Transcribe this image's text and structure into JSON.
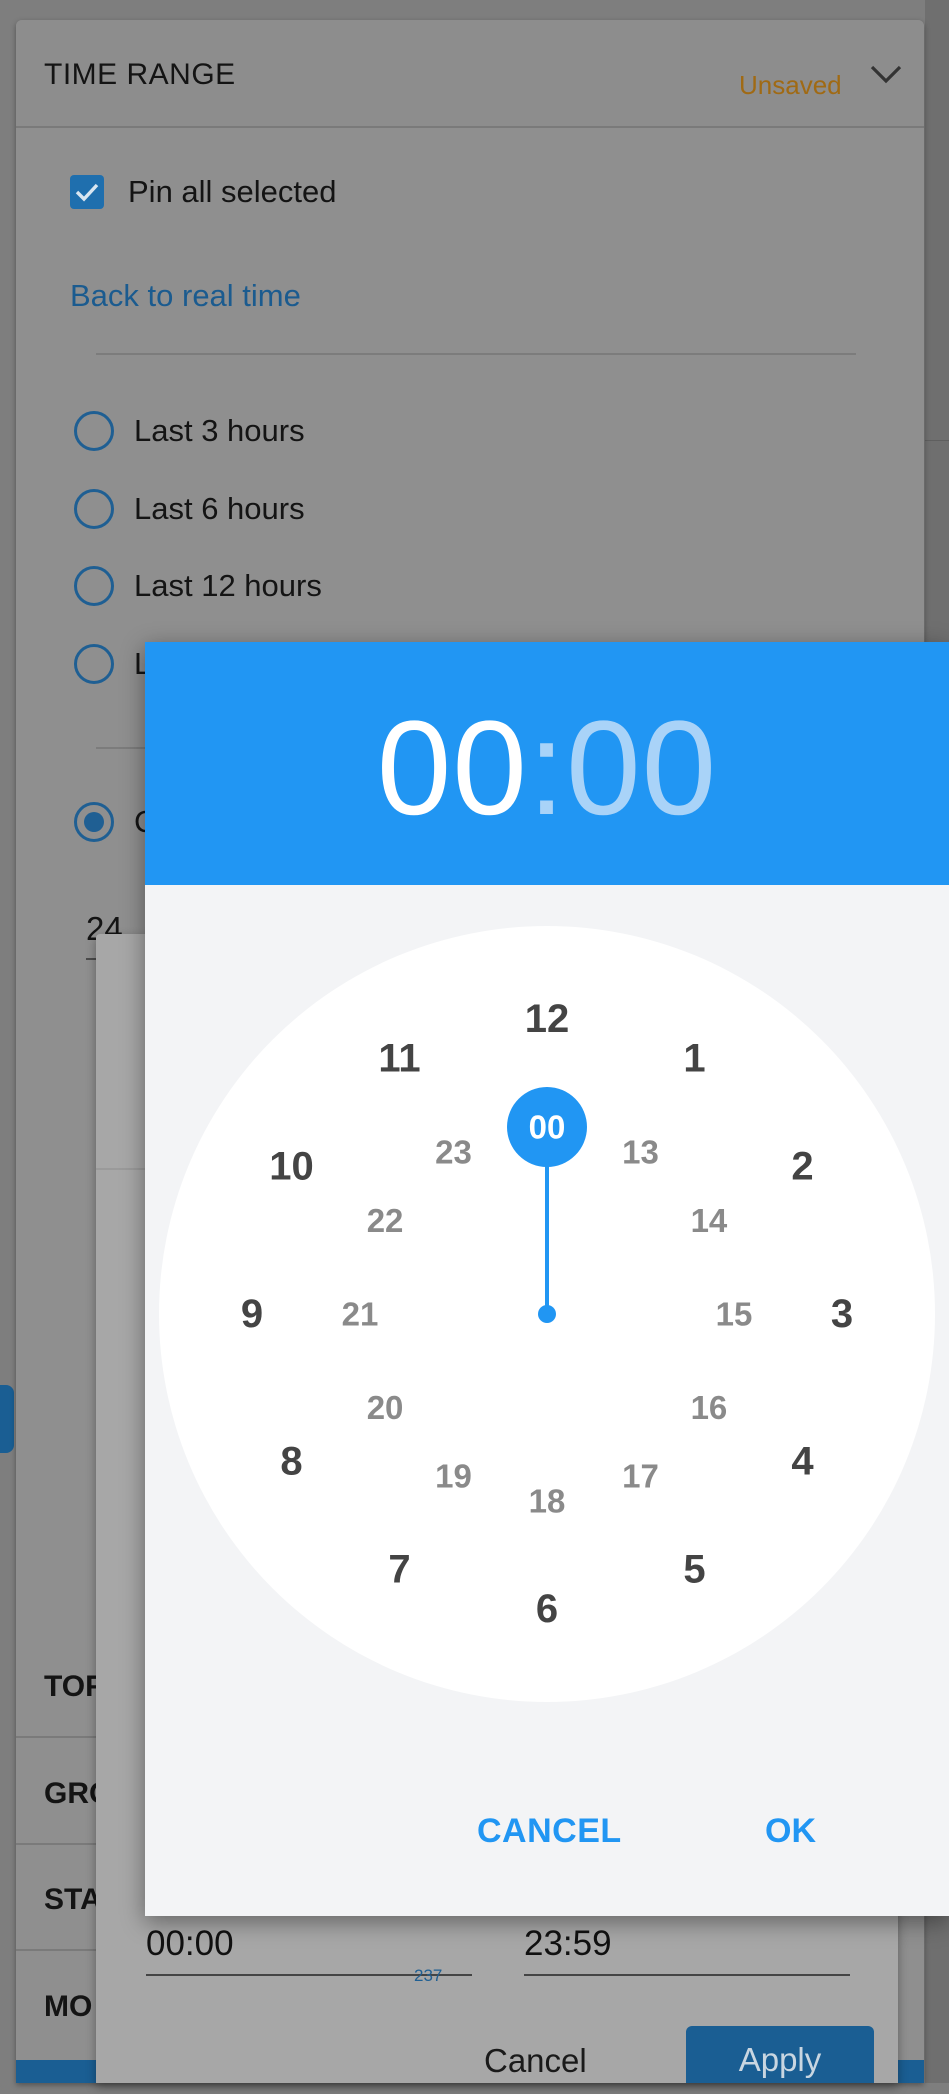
{
  "panel": {
    "title": "TIME RANGE",
    "status": "Unsaved",
    "pin_label": "Pin all selected",
    "back_link": "Back to real time",
    "radios": [
      {
        "label": "Last 3 hours",
        "selected": false
      },
      {
        "label": "Last 6 hours",
        "selected": false
      },
      {
        "label": "Last 12 hours",
        "selected": false
      },
      {
        "label": "L",
        "selected": false
      },
      {
        "label": "C",
        "selected": true
      }
    ],
    "custom_value": "24",
    "left_sections": [
      "TOF",
      "GRO",
      "STA",
      "MO"
    ]
  },
  "range_dialog": {
    "from_time": "00:00",
    "to_time": "23:59",
    "slider_value": "237",
    "cancel_label": "Cancel",
    "apply_label": "Apply"
  },
  "time_picker": {
    "hour": "00",
    "separator": ":",
    "minute": "00",
    "selected_value": "00",
    "outer_ring": [
      "12",
      "1",
      "2",
      "3",
      "4",
      "5",
      "6",
      "7",
      "8",
      "9",
      "10",
      "11"
    ],
    "inner_ring": [
      "00",
      "13",
      "14",
      "15",
      "16",
      "17",
      "18",
      "19",
      "20",
      "21",
      "22",
      "23"
    ],
    "cancel_label": "CANCEL",
    "ok_label": "OK",
    "accent_color": "#2196f3"
  }
}
